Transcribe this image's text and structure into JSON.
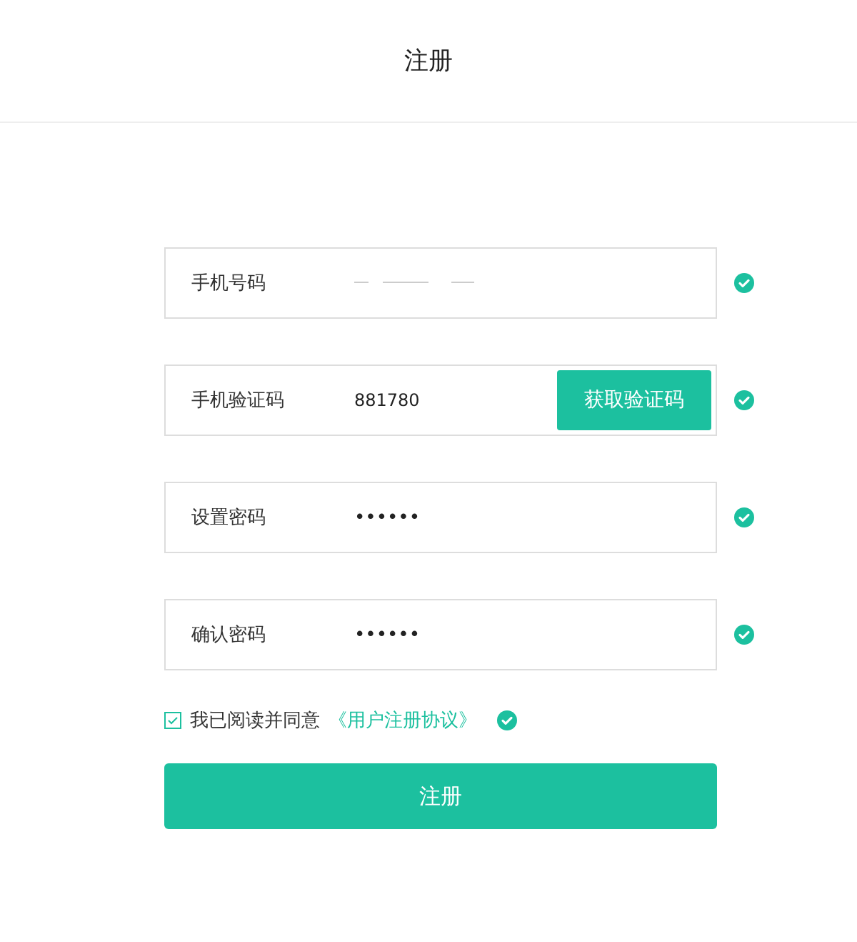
{
  "header": {
    "title": "注册"
  },
  "fields": [
    {
      "kind": "phone",
      "label": "手机号码",
      "redacted": true,
      "valid": true
    },
    {
      "kind": "code",
      "label": "手机验证码",
      "value": "881780",
      "button": "获取验证码",
      "valid": true
    },
    {
      "kind": "password",
      "label": "设置密码",
      "value": "••••••",
      "valid": true
    },
    {
      "kind": "password",
      "label": "确认密码",
      "value": "••••••",
      "valid": true
    }
  ],
  "agreement": {
    "checked": true,
    "text": "我已阅读并同意",
    "link": "《用户注册协议》",
    "valid": true
  },
  "submit": "注册"
}
